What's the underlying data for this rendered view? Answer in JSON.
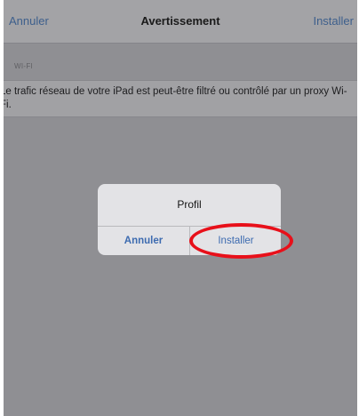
{
  "navbar": {
    "cancel_label": "Annuler",
    "title": "Avertissement",
    "install_label": "Installer"
  },
  "section": {
    "header": "WI-FI",
    "text": "Le trafic réseau de votre iPad est peut-être filtré ou contrôlé par un proxy Wi-Fi."
  },
  "alert": {
    "title": "Profil",
    "cancel_label": "Annuler",
    "install_label": "Installer"
  },
  "colors": {
    "accent": "#3d6bb0",
    "highlight": "#e8101a",
    "dim_overlay": "#8f8f93"
  }
}
